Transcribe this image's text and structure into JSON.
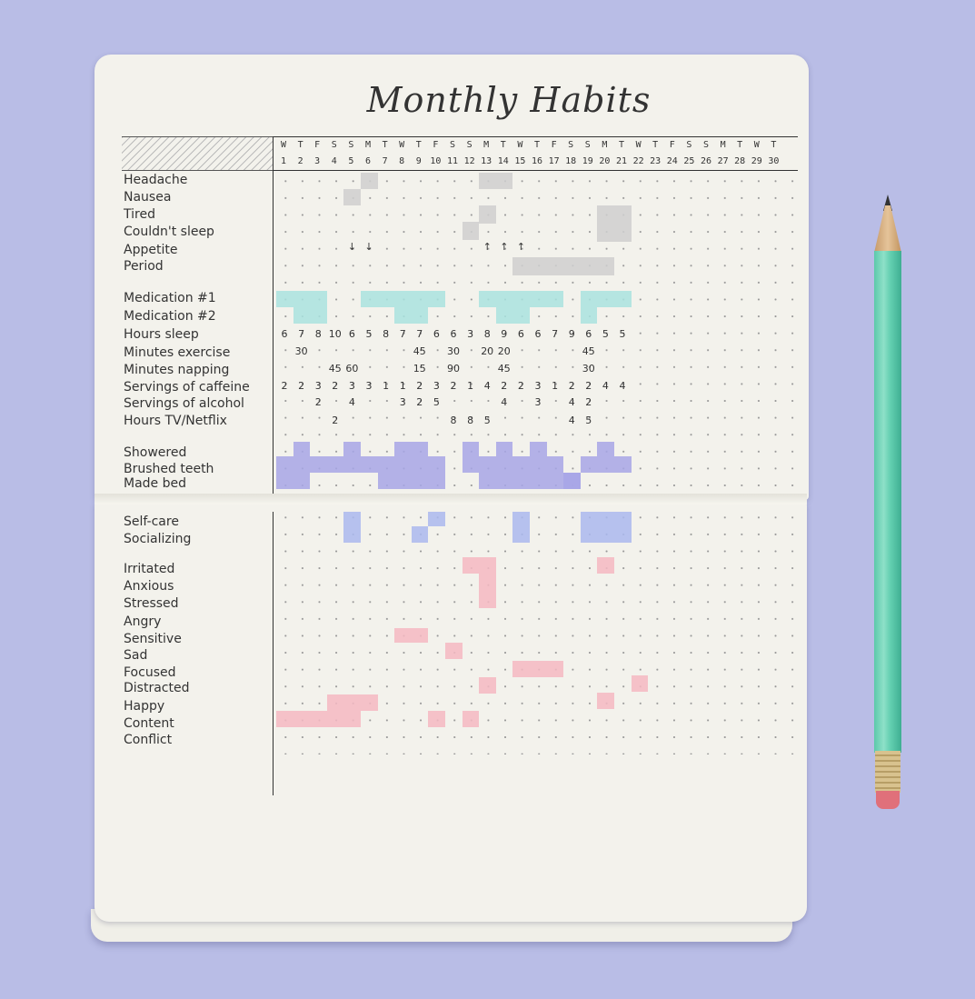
{
  "title": "Monthly Habits",
  "days": [
    "W",
    "T",
    "F",
    "S",
    "S",
    "M",
    "T",
    "W",
    "T",
    "F",
    "S",
    "S",
    "M",
    "T",
    "W",
    "T",
    "F",
    "S",
    "S",
    "M",
    "T",
    "W",
    "T",
    "F",
    "S",
    "S",
    "M",
    "T",
    "W",
    "T"
  ],
  "dates": [
    "1",
    "2",
    "3",
    "4",
    "5",
    "6",
    "7",
    "8",
    "9",
    "10",
    "11",
    "12",
    "13",
    "14",
    "15",
    "16",
    "17",
    "18",
    "19",
    "20",
    "21",
    "22",
    "23",
    "24",
    "25",
    "26",
    "27",
    "28",
    "29",
    "30"
  ],
  "labels_top": [
    "Headache",
    "Nausea",
    "Tired",
    "Couldn't sleep",
    "Appetite",
    "Period",
    "Medication #1",
    "Medication #2",
    "Hours sleep",
    "Minutes exercise",
    "Minutes napping",
    "Servings of caffeine",
    "Servings of alcohol",
    "Hours TV/Netflix",
    "Showered",
    "Brushed teeth",
    "Made bed"
  ],
  "labels_bottom": [
    "Self-care",
    "Socializing",
    "Irritated",
    "Anxious",
    "Stressed",
    "Angry",
    "Sensitive",
    "Sad",
    "Focused",
    "Distracted",
    "Happy",
    "Content",
    "Conflict"
  ],
  "hours_sleep": [
    "6",
    "7",
    "8",
    "10",
    "6",
    "5",
    "8",
    "7",
    "7",
    "6",
    "6",
    "3",
    "8",
    "9",
    "6",
    "6",
    "7",
    "9",
    "6",
    "5",
    "5"
  ],
  "minutes_exercise": [
    "30",
    "45",
    "30",
    "20",
    "20",
    "45"
  ],
  "minutes_napping": [
    "45",
    "60",
    "15",
    "90",
    "45",
    "30"
  ],
  "servings_caffeine": [
    "2",
    "2",
    "3",
    "2",
    "3",
    "3",
    "1",
    "1",
    "2",
    "3",
    "2",
    "1",
    "4",
    "2",
    "2",
    "3",
    "1",
    "2",
    "2",
    "4",
    "4"
  ],
  "servings_alcohol": [
    "2",
    "4",
    "3",
    "2",
    "5",
    "4",
    "3",
    "4",
    "2"
  ],
  "hours_tv": [
    "2",
    "8",
    "8",
    "5",
    "4",
    "5"
  ],
  "appetite_marks": [
    "↓",
    "↓",
    "↑",
    "↑",
    "↑"
  ],
  "colors": {
    "background": "#b9bde6",
    "paper": "#f3f2ec",
    "gray": "#cfcfcf",
    "teal": "#a9e3df",
    "purple": "#a7a6e6",
    "blue": "#aab8ee",
    "pink": "#f4b9c2",
    "pencil": "#5cc9ab"
  }
}
